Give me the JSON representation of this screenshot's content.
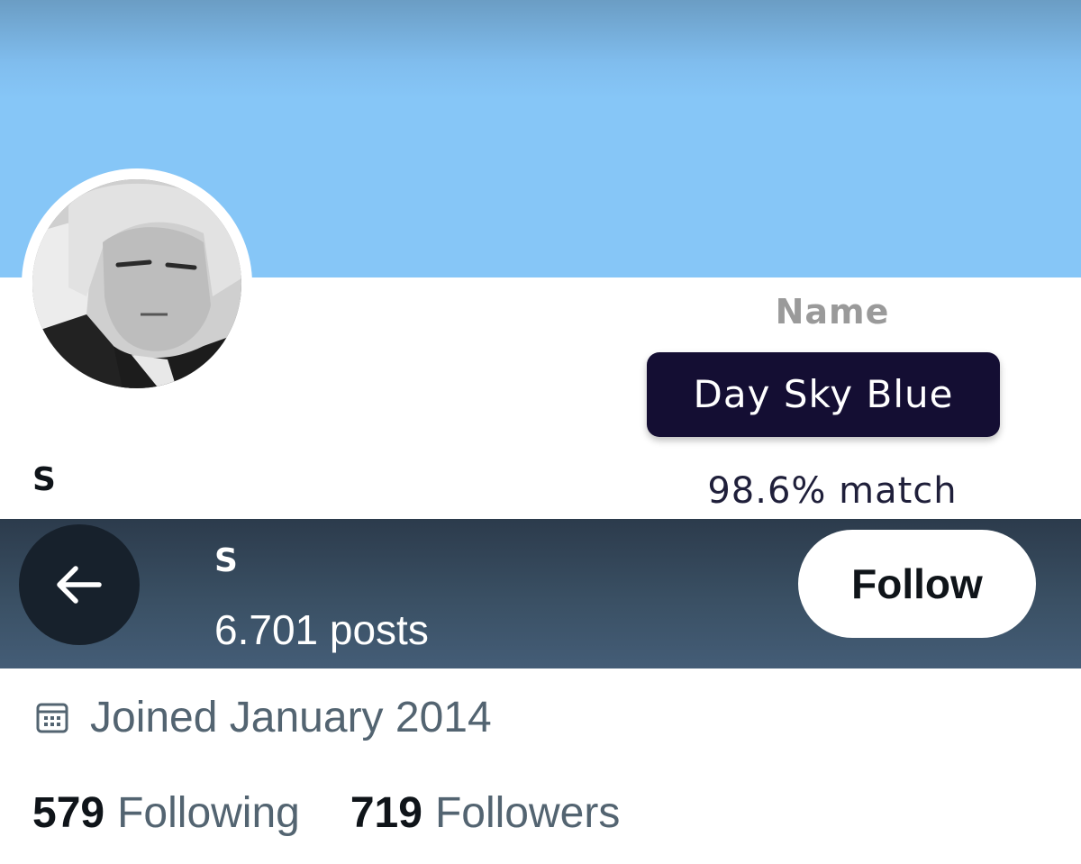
{
  "profile": {
    "display_name": "S",
    "joined": "Joined January 2014",
    "following_count": "579",
    "following_label": "Following",
    "followers_count": "719",
    "followers_label": "Followers"
  },
  "color_match": {
    "label": "Name",
    "color_name": "Day Sky Blue",
    "match_text": "98.6% match",
    "pill_color": "#140e33",
    "banner_color": "#86c6f7"
  },
  "topbar": {
    "name": "S",
    "posts": "6.701 posts",
    "follow_label": "Follow"
  },
  "icons": {
    "back": "arrow-left-icon",
    "calendar": "calendar-icon"
  }
}
